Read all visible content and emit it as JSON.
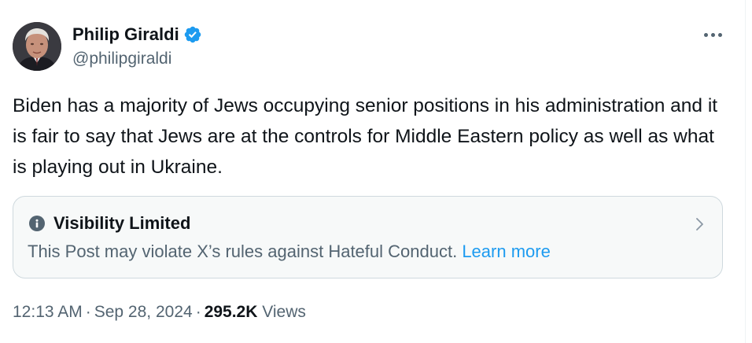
{
  "author": {
    "display_name": "Philip Giraldi",
    "handle": "@philipgiraldi",
    "verified": true
  },
  "post": {
    "text": "Biden has a majority of Jews occupying senior positions in his administration and it is fair to say that Jews are at the controls for Middle Eastern policy as well as what is playing out in Ukraine."
  },
  "notice": {
    "icon": "info-icon",
    "title": "Visibility Limited",
    "description": "This Post may violate X’s rules against Hateful Conduct.",
    "link_label": "Learn more"
  },
  "meta": {
    "time": "12:13 AM",
    "date": "Sep 28, 2024",
    "separator": "·",
    "views_count": "295.2K",
    "views_label": "Views"
  },
  "colors": {
    "text_primary": "#0f1419",
    "text_secondary": "#536471",
    "accent": "#1d9bf0",
    "notice_bg": "#f7f9f9",
    "border": "#cfd9de"
  }
}
